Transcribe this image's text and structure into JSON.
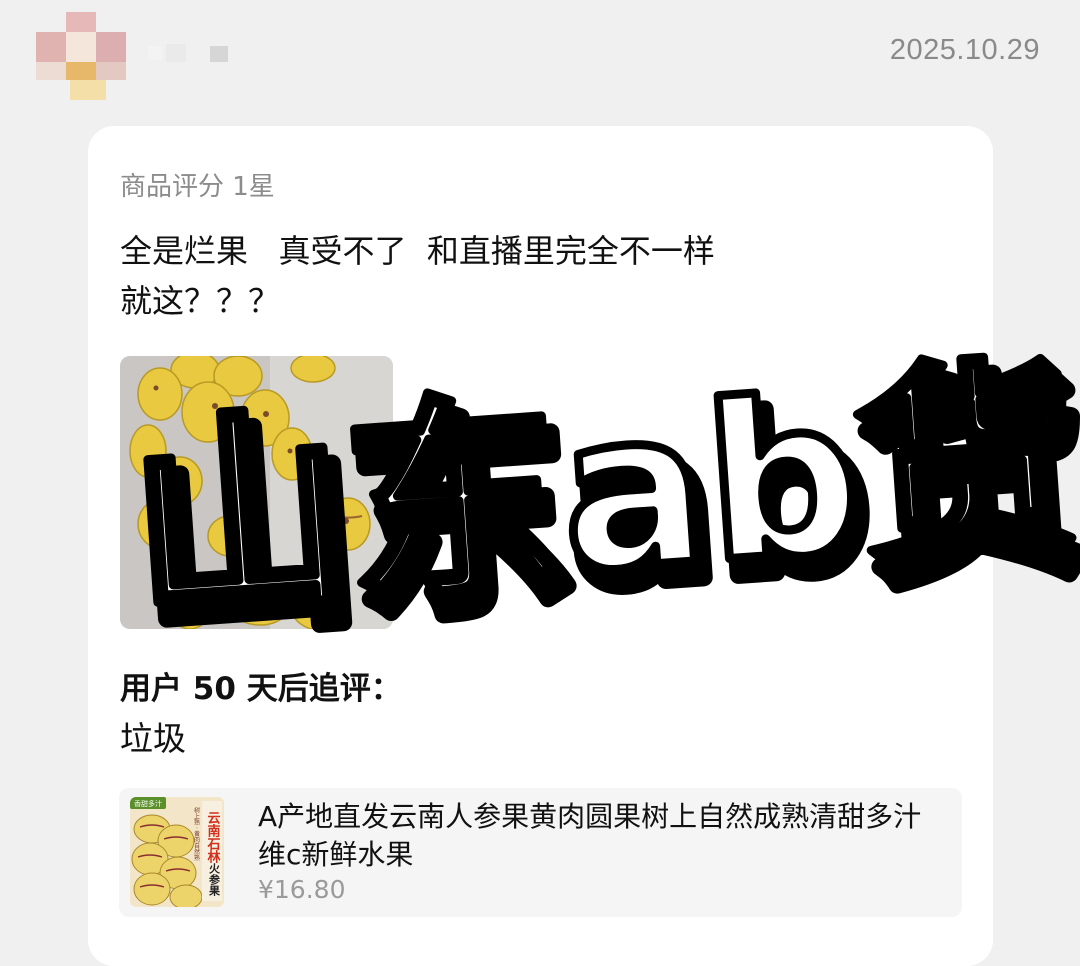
{
  "header": {
    "date": "2025.10.29"
  },
  "review": {
    "rating_label": "商品评分 1星",
    "text_line1": "全是烂果   真受不了  和直播里完全不一样",
    "text_line2": "就这？？？"
  },
  "followup": {
    "title": "用户 50 天后追评：",
    "text": "垃圾"
  },
  "product": {
    "title": "A产地直发云南人参果黄肉圆果树上自然成熟清甜多汁维c新鲜水果",
    "price": "¥16.80",
    "thumb_badge": "香甜多汁",
    "thumb_text1": "云南石林",
    "thumb_text2": "火参果",
    "thumb_small": "树上熟 · 黄肉自然熟"
  },
  "overlay": {
    "caption": "山东ab货"
  },
  "colors": {
    "background": "#f0f0f0",
    "card": "#ffffff",
    "muted_text": "#8c8c8c",
    "product_bg": "#f5f5f5",
    "fruit_yellow": "#e8c93f",
    "thumb_red": "#d0301c"
  }
}
